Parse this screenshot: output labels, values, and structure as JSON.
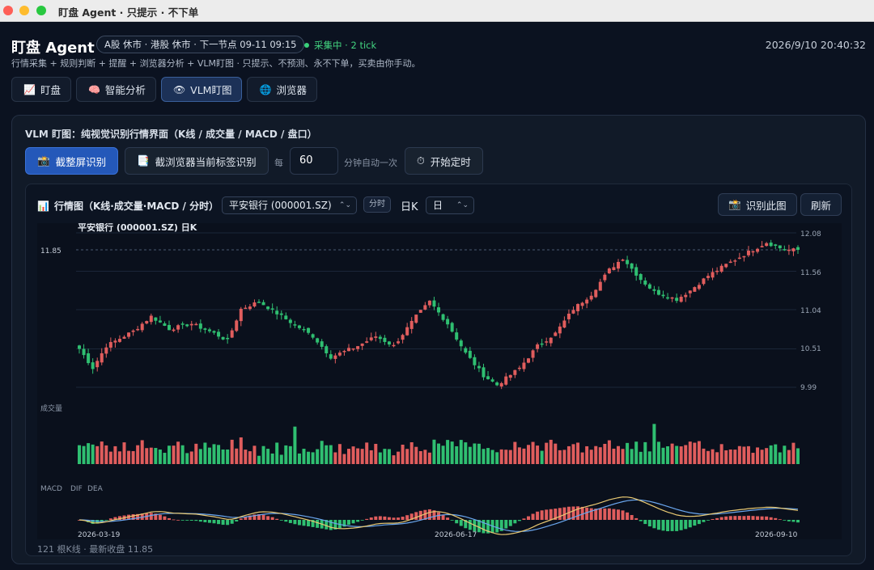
{
  "window": {
    "title": "盯盘 Agent · 只提示 · 不下单"
  },
  "header": {
    "app_title": "盯盘 Agent",
    "market_status": "A股 休市 · 港股 休市 · 下一节点 09-11 09:15",
    "live_status": "采集中 · 2 tick",
    "subtitle": "行情采集 + 规则判断 + 提醒 + 浏览器分析 + VLM盯图 · 只提示、不预测、永不下单，买卖由你手动。",
    "datetime": "2026/9/10 20:40:32"
  },
  "tabs": [
    {
      "label": "盯盘",
      "icon": "chart-icon"
    },
    {
      "label": "智能分析",
      "icon": "brain-icon"
    },
    {
      "label": "VLM盯图",
      "icon": "eye-icon"
    },
    {
      "label": "浏览器",
      "icon": "globe-icon"
    }
  ],
  "vlm": {
    "title": "VLM 盯图：纯视觉识别行情界面（K线 / 成交量 / MACD / 盘口）",
    "capture_full_label": "截整屏识别",
    "capture_tab_label": "截浏览器当前标签识别",
    "every_label": "每",
    "interval_value": "60",
    "interval_suffix": "分钟自动一次",
    "timer_label": "开始定时"
  },
  "chart_panel": {
    "title": "行情图（K线·成交量·MACD / 分时）",
    "stock_select": "平安银行 (000001.SZ)",
    "fenshi_label": "分时",
    "period_text": "日K",
    "period_select": "日",
    "identify_label": "识别此图",
    "refresh_label": "刷新",
    "footer": "121 根K线 · 最新收盘 11.85"
  },
  "colors": {
    "up": "#e05d5d",
    "down": "#2fbf71",
    "dif": "#e8c872",
    "dea": "#6aa6ee"
  },
  "chart_data": {
    "type": "candlestick",
    "title": "平安银行 (000001.SZ) 日K",
    "bars": 121,
    "last_close": 11.85,
    "last_close_label": "11.85",
    "price_ticks": [
      "12.08",
      "11.56",
      "11.04",
      "10.51",
      "9.99"
    ],
    "price_range": [
      9.99,
      12.08
    ],
    "x_labels": [
      "2026-03-19",
      "2026-06-17",
      "2026-09-10"
    ],
    "volume_label": "成交量",
    "macd_label": "MACD",
    "dif_label": "DIF",
    "dea_label": "DEA",
    "close_anchors": [
      [
        0,
        10.51
      ],
      [
        3,
        10.25
      ],
      [
        6,
        10.55
      ],
      [
        12,
        10.75
      ],
      [
        16,
        10.95
      ],
      [
        20,
        10.78
      ],
      [
        25,
        10.85
      ],
      [
        30,
        10.72
      ],
      [
        33,
        10.62
      ],
      [
        36,
        11.05
      ],
      [
        40,
        11.15
      ],
      [
        45,
        10.95
      ],
      [
        52,
        10.68
      ],
      [
        56,
        10.4
      ],
      [
        62,
        10.55
      ],
      [
        66,
        10.68
      ],
      [
        70,
        10.55
      ],
      [
        75,
        10.95
      ],
      [
        78,
        11.15
      ],
      [
        82,
        10.85
      ],
      [
        86,
        10.45
      ],
      [
        90,
        10.15
      ],
      [
        93,
        10.02
      ],
      [
        98,
        10.25
      ],
      [
        102,
        10.55
      ],
      [
        106,
        10.72
      ],
      [
        110,
        11.05
      ],
      [
        114,
        11.25
      ],
      [
        118,
        11.58
      ],
      [
        121,
        11.74
      ],
      [
        125,
        11.45
      ],
      [
        128,
        11.28
      ],
      [
        133,
        11.18
      ],
      [
        136,
        11.3
      ],
      [
        140,
        11.5
      ],
      [
        144,
        11.65
      ],
      [
        149,
        11.82
      ],
      [
        153,
        11.95
      ],
      [
        157,
        11.85
      ],
      [
        160,
        11.85
      ]
    ]
  }
}
